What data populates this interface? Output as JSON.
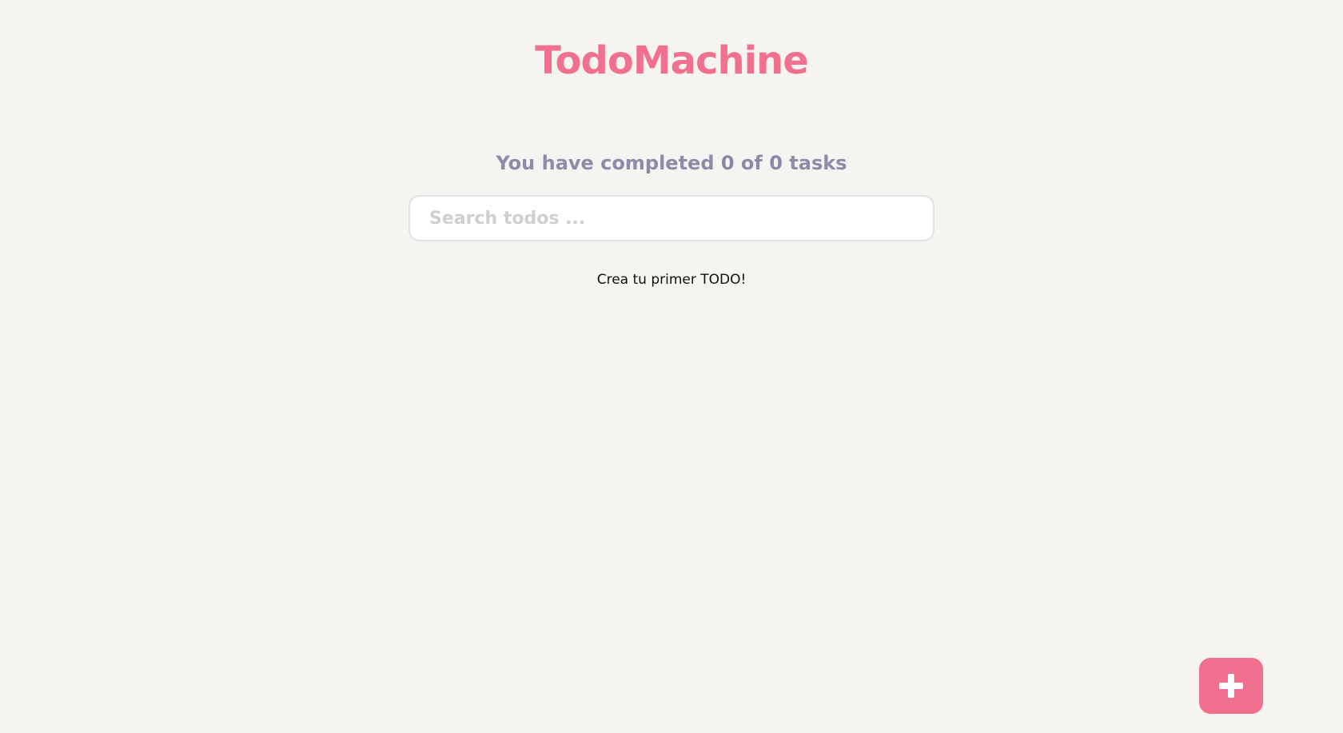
{
  "app": {
    "title": "TodoMachine"
  },
  "counter": {
    "prefix": "You have completed",
    "completed": "0",
    "middle": "of",
    "total": "0",
    "suffix": "tasks"
  },
  "search": {
    "placeholder": "Search todos ...",
    "value": ""
  },
  "empty_state": {
    "message": "Crea tu primer TODO!"
  },
  "add_button": {
    "icon": "plus-icon"
  },
  "colors": {
    "accent": "#f2708f",
    "background": "#f5f4f1",
    "counter_text": "#8e8aa8"
  }
}
